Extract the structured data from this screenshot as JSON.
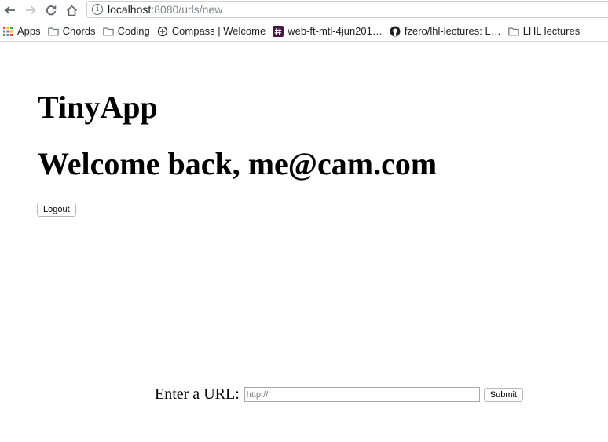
{
  "browser": {
    "url_host": "localhost",
    "url_rest": ":8080/urls/new"
  },
  "bookmarks": [
    {
      "label": "Apps",
      "icon": "apps-grid-icon"
    },
    {
      "label": "Chords",
      "icon": "folder-icon"
    },
    {
      "label": "Coding",
      "icon": "folder-icon"
    },
    {
      "label": "Compass | Welcome",
      "icon": "compass-icon"
    },
    {
      "label": "web-ft-mtl-4jun201…",
      "icon": "slack-hash-icon"
    },
    {
      "label": "fzero/lhl-lectures: L…",
      "icon": "github-icon"
    },
    {
      "label": "LHL lectures",
      "icon": "folder-icon"
    }
  ],
  "page": {
    "app_title": "TinyApp",
    "welcome": "Welcome back, me@cam.com",
    "logout_label": "Logout",
    "form": {
      "label": "Enter a URL:",
      "placeholder": "http://",
      "value": "",
      "submit_label": "Submit"
    }
  }
}
